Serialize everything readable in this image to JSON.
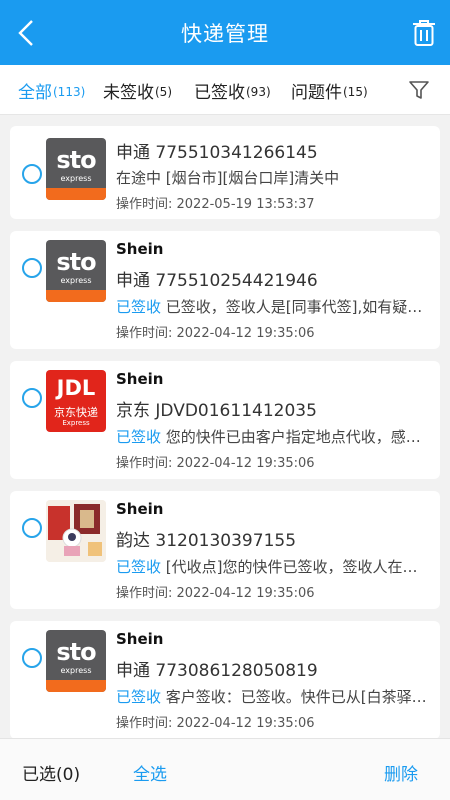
{
  "header": {
    "title": "快递管理",
    "back_icon": "chevron-left-icon",
    "trash_icon": "trash-icon"
  },
  "tabs": [
    {
      "label": "全部",
      "count": "(113)",
      "active": true
    },
    {
      "label": "未签收",
      "count": "(5)",
      "active": false
    },
    {
      "label": "已签收",
      "count": "(93)",
      "active": false
    },
    {
      "label": "问题件",
      "count": "(15)",
      "active": false
    }
  ],
  "filter_icon": "filter-icon",
  "items": [
    {
      "shop": "",
      "logo": "sto",
      "tracking": "申通 775510341266145",
      "status_tag": "",
      "status_text": "在途中 [烟台市][烟台口岸]清关中",
      "op_time": "操作时间: 2022-05-19 13:53:37"
    },
    {
      "shop": "Shein",
      "logo": "sto",
      "tracking": "申通 775510254421946",
      "status_tag": "已签收",
      "status_text": " 已签收，签收人是[同事代签],如有疑问请联系派件员",
      "op_time": "操作时间: 2022-04-12 19:35:06"
    },
    {
      "shop": "Shein",
      "logo": "jdl",
      "tracking": "京东 JDVD01611412035",
      "status_tag": "已签收",
      "status_text": " 您的快件已由客户指定地点代收，感谢您使用京东物流",
      "op_time": "操作时间: 2022-04-12 19:35:06"
    },
    {
      "shop": "Shein",
      "logo": "photo",
      "tracking": "韵达 3120130397155",
      "status_tag": "已签收",
      "status_text": " [代收点]您的快件已签收，签收人在驿站代收",
      "op_time": "操作时间: 2022-04-12 19:35:06"
    },
    {
      "shop": "Shein",
      "logo": "sto",
      "tracking": "申通 773086128050819",
      "status_tag": "已签收",
      "status_text": " 客户签收：已签收。快件已从[白茶驿站]取出",
      "op_time": "操作时间: 2022-04-12 19:35:06"
    }
  ],
  "logos": {
    "sto": {
      "text": "sto",
      "sub": "express"
    },
    "jdl": {
      "text": "JDL",
      "sub": "京东快递",
      "sub2": "Express"
    }
  },
  "bottom": {
    "selected_label": "已选(0)",
    "select_all_label": "全选",
    "delete_label": "删除"
  },
  "colors": {
    "primary": "#1a9bf0",
    "sto_gray": "#59595b",
    "sto_orange": "#f26b1d",
    "jd_red": "#e1251b"
  }
}
